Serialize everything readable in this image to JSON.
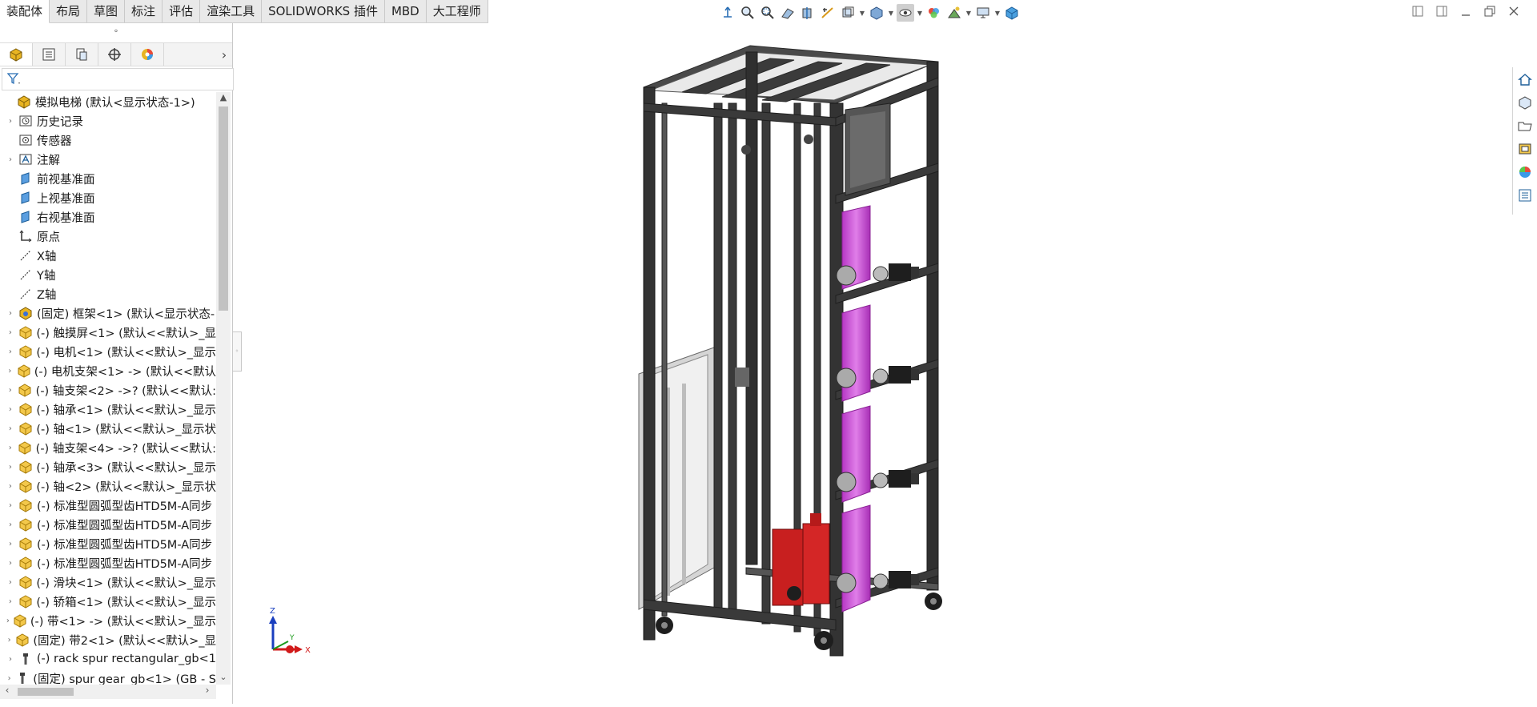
{
  "tabs": [
    {
      "label": "装配体",
      "active": true
    },
    {
      "label": "布局"
    },
    {
      "label": "草图"
    },
    {
      "label": "标注"
    },
    {
      "label": "评估"
    },
    {
      "label": "渲染工具"
    },
    {
      "label": "SOLIDWORKS 插件"
    },
    {
      "label": "MBD"
    },
    {
      "label": "大工程师"
    }
  ],
  "hud_icons": [
    "view-orientation-icon",
    "zoom-to-fit-icon",
    "zoom-area-icon",
    "previous-view-icon",
    "section-view-icon",
    "dynamic-annotation-icon",
    "view-orientation-dropdown-icon",
    "display-style-icon",
    "hide-show-items-icon",
    "edit-appearance-icon",
    "apply-scene-icon",
    "view-settings-icon",
    "3d-view-icon"
  ],
  "feature_manager": {
    "tabs": [
      "feature-manager-tab",
      "property-manager-tab",
      "configuration-manager-tab",
      "dimxpert-manager-tab",
      "display-manager-tab"
    ],
    "tree": [
      {
        "label": "模拟电梯  (默认<显示状态-1>)",
        "icon": "assembly-icon",
        "expand": false,
        "indent": 0
      },
      {
        "label": "历史记录",
        "icon": "history-icon",
        "expand": true,
        "indent": 1
      },
      {
        "label": "传感器",
        "icon": "sensor-icon",
        "expand": false,
        "indent": 1
      },
      {
        "label": "注解",
        "icon": "annotations-icon",
        "expand": true,
        "indent": 1
      },
      {
        "label": "前视基准面",
        "icon": "plane-icon",
        "expand": false,
        "indent": 1
      },
      {
        "label": "上视基准面",
        "icon": "plane-icon",
        "expand": false,
        "indent": 1
      },
      {
        "label": "右视基准面",
        "icon": "plane-icon",
        "expand": false,
        "indent": 1
      },
      {
        "label": "原点",
        "icon": "origin-icon",
        "expand": false,
        "indent": 1
      },
      {
        "label": "X轴",
        "icon": "axis-icon",
        "expand": false,
        "indent": 1
      },
      {
        "label": "Y轴",
        "icon": "axis-icon",
        "expand": false,
        "indent": 1
      },
      {
        "label": "Z轴",
        "icon": "axis-icon",
        "expand": false,
        "indent": 1
      },
      {
        "label": "(固定) 框架<1> (默认<显示状态-",
        "icon": "subassembly-icon",
        "expand": true,
        "indent": 1
      },
      {
        "label": "(-) 触摸屏<1> (默认<<默认>_显",
        "icon": "part-icon",
        "expand": true,
        "indent": 1
      },
      {
        "label": "(-) 电机<1> (默认<<默认>_显示",
        "icon": "part-icon",
        "expand": true,
        "indent": 1
      },
      {
        "label": "(-) 电机支架<1> -> (默认<<默认",
        "icon": "part-icon",
        "expand": true,
        "indent": 1
      },
      {
        "label": "(-) 轴支架<2> ->? (默认<<默认:",
        "icon": "part-icon",
        "expand": true,
        "indent": 1
      },
      {
        "label": "(-) 轴承<1> (默认<<默认>_显示",
        "icon": "part-icon",
        "expand": true,
        "indent": 1
      },
      {
        "label": "(-) 轴<1> (默认<<默认>_显示状",
        "icon": "part-icon",
        "expand": true,
        "indent": 1
      },
      {
        "label": "(-) 轴支架<4> ->? (默认<<默认:",
        "icon": "part-icon",
        "expand": true,
        "indent": 1
      },
      {
        "label": "(-) 轴承<3> (默认<<默认>_显示",
        "icon": "part-icon",
        "expand": true,
        "indent": 1
      },
      {
        "label": "(-) 轴<2> (默认<<默认>_显示状",
        "icon": "part-icon",
        "expand": true,
        "indent": 1
      },
      {
        "label": "(-) 标准型圆弧型齿HTD5M-A同步",
        "icon": "part-icon",
        "expand": true,
        "indent": 1
      },
      {
        "label": "(-) 标准型圆弧型齿HTD5M-A同步",
        "icon": "part-icon",
        "expand": true,
        "indent": 1
      },
      {
        "label": "(-) 标准型圆弧型齿HTD5M-A同步",
        "icon": "part-icon",
        "expand": true,
        "indent": 1
      },
      {
        "label": "(-) 标准型圆弧型齿HTD5M-A同步",
        "icon": "part-icon",
        "expand": true,
        "indent": 1
      },
      {
        "label": "(-) 滑块<1> (默认<<默认>_显示",
        "icon": "part-icon",
        "expand": true,
        "indent": 1
      },
      {
        "label": "(-) 轿箱<1> (默认<<默认>_显示",
        "icon": "part-icon",
        "expand": true,
        "indent": 1
      },
      {
        "label": "(-) 带<1> -> (默认<<默认>_显示",
        "icon": "part-icon",
        "expand": true,
        "indent": 1
      },
      {
        "label": "(固定) 带2<1> (默认<<默认>_显",
        "icon": "part-icon",
        "expand": true,
        "indent": 1
      },
      {
        "label": "(-) rack spur rectangular_gb<1",
        "icon": "toolbox-part-icon",
        "expand": true,
        "indent": 1
      },
      {
        "label": "(固定) spur gear_gb<1> (GB - S",
        "icon": "toolbox-part-icon",
        "expand": true,
        "indent": 1
      }
    ]
  },
  "triad": {
    "x": "X",
    "y": "Y",
    "z": "Z"
  },
  "taskpane_icons": [
    "solidworks-resources-icon",
    "design-library-icon",
    "file-explorer-icon",
    "view-palette-icon",
    "appearances-scenes-icon",
    "custom-properties-icon"
  ],
  "colors": {
    "accent": "#1e6fbf",
    "frame": "#2e2e2e",
    "belt": "#cc4fd6",
    "car": "#d42626",
    "triad_x": "#d11a1a",
    "triad_y": "#1a9a1a",
    "triad_z": "#1a3fbf"
  }
}
